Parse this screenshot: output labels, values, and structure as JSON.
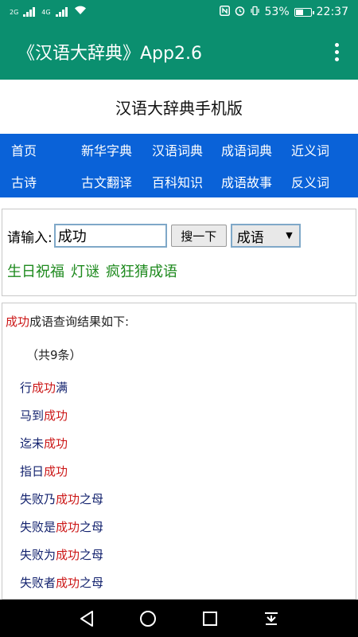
{
  "status_bar": {
    "signal_left": "2G",
    "signal_right": "4G",
    "battery_percent": "53%",
    "battery_level": 53,
    "time": "22:37"
  },
  "app_bar": {
    "title": "《汉语大辞典》App2.6"
  },
  "site_title": "汉语大辞典手机版",
  "nav": {
    "row1": [
      "首页",
      "新华字典",
      "汉语词典",
      "成语词典",
      "近义词"
    ],
    "row2": [
      "古诗",
      "古文翻译",
      "百科知识",
      "成语故事",
      "反义词"
    ]
  },
  "search": {
    "label": "请输入:",
    "value": "成功",
    "button_label": "搜一下",
    "select_value": "成语",
    "links": [
      "生日祝福",
      "灯谜",
      "疯狂猜成语"
    ]
  },
  "results": {
    "keyword": "成功",
    "header_suffix": "成语查询结果如下:",
    "count": "（共9条）",
    "items": [
      {
        "pre": "行",
        "kw": "成功",
        "post": "满"
      },
      {
        "pre": "马到",
        "kw": "成功",
        "post": ""
      },
      {
        "pre": "迄未",
        "kw": "成功",
        "post": ""
      },
      {
        "pre": "指日",
        "kw": "成功",
        "post": ""
      },
      {
        "pre": "失败乃",
        "kw": "成功",
        "post": "之母"
      },
      {
        "pre": "失败是",
        "kw": "成功",
        "post": "之母"
      },
      {
        "pre": "失败为",
        "kw": "成功",
        "post": "之母"
      },
      {
        "pre": "失败者",
        "kw": "成功",
        "post": "之母"
      }
    ]
  },
  "colors": {
    "primary": "#0b8f6f",
    "nav_blue": "#0a62d8",
    "highlight_red": "#cc1818",
    "link_green": "#1e8a1e"
  }
}
